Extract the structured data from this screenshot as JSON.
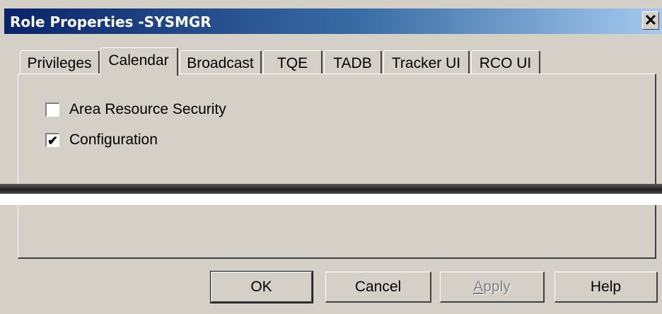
{
  "window": {
    "title": "Role Properties -SYSMGR",
    "close_label": "✕"
  },
  "tabs": [
    {
      "label": "Privileges"
    },
    {
      "label": "Calendar"
    },
    {
      "label": "Broadcast"
    },
    {
      "label": "TQE"
    },
    {
      "label": "TADB"
    },
    {
      "label": "Tracker UI"
    },
    {
      "label": "RCO UI"
    }
  ],
  "active_tab": "Calendar",
  "privileges": [
    {
      "label": "Area Resource Security",
      "checked": false,
      "mark": ""
    },
    {
      "label": "Configuration",
      "checked": true,
      "mark": "✔"
    }
  ],
  "buttons": {
    "ok": "OK",
    "cancel": "Cancel",
    "apply_first": "A",
    "apply_rest": "pply",
    "help": "Help"
  }
}
